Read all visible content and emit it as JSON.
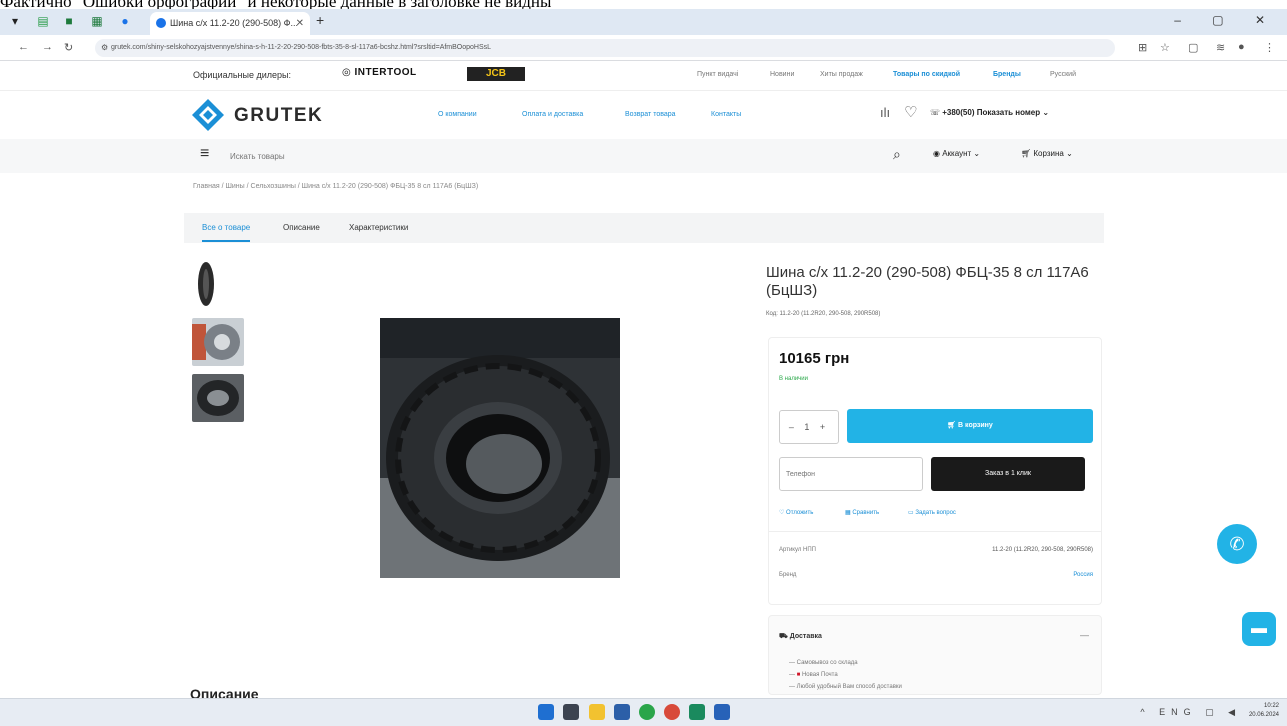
{
  "caption": "Фактично “Ошибки орфографии” и некоторые данные в заголовке не видны",
  "browser": {
    "tab_title": "Шина с/х 11.2-20 (290-508) Ф...",
    "tab_close": "✕",
    "new_tab": "+",
    "url": "grutek.com/shiny-selskohozyajstvennye/shina-s-h-11-2-20-290-508-fbts-35-8-sl-117a6-bcshz.html?srsltid=AfmBOopoHSsL",
    "window_controls": "–  ▢  ✕"
  },
  "dealer_bar": {
    "label": "Официальные дилеры:",
    "intertool": "INTERTOOL",
    "jcb": "JCB",
    "links": [
      "Пункт видачі",
      "Новини",
      "Хиты продаж",
      "Товары по скидкой",
      "Бренды",
      "Русский"
    ]
  },
  "header": {
    "brand": "GRUTEK",
    "nav": [
      "О компании",
      "Оплата и доставка",
      "Возврат товара",
      "Контакты"
    ],
    "phone": "+380(50) Показать номер"
  },
  "search": {
    "placeholder": "Искать товары",
    "account": "Аккаунт",
    "cart": "Корзина"
  },
  "breadcrumb": "Главная / Шины / Сельхозшины / Шина с/х 11.2-20 (290-508) ФБЦ-35 8 сл 117А6 (БцШЗ)",
  "tabs": [
    "Все о товаре",
    "Описание",
    "Характеристики"
  ],
  "product": {
    "title": "Шина с/х 11.2-20 (290-508) ФБЦ-35 8 сл 117А6 (БцШЗ)",
    "code": "Код: 11.2-20 (11.2R20, 290-508, 290R508)",
    "price": "10165 грн",
    "stock": "В наличии",
    "qty": "– 1 +",
    "add_to_cart": "В корзину",
    "phone_placeholder": "Телефон",
    "order_one_click": "Заказ в 1 клик",
    "actions": [
      "Отложить",
      "Сравнить",
      "Задать вопрос"
    ],
    "specs": [
      {
        "key": "Артикул НПП",
        "value": "11.2-20 (11.2R20, 290-508, 290R508)"
      },
      {
        "key": "Бренд",
        "value": "Россия"
      }
    ]
  },
  "delivery": {
    "title": "Доставка",
    "items": [
      "Самовывоз со склада",
      "Новая Почта",
      "Любой удобный Вам способ доставки"
    ]
  },
  "description_heading": "Описание",
  "taskbar": {
    "tray": "^ ENG ▢ ◀",
    "time": "10:22",
    "date": "20.06.2024"
  },
  "colors": {
    "accent": "#22b3e6",
    "brand_blue": "#1b8fd6",
    "dark_button": "#1a1a1a"
  }
}
